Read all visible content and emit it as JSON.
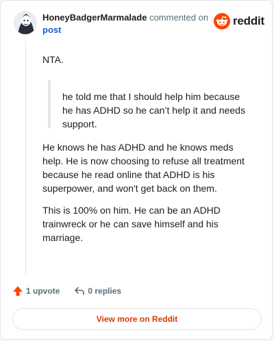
{
  "header": {
    "username": "HoneyBadgerMarmalade",
    "commented_text": "commented on",
    "post_link": "post",
    "logo_text": "reddit"
  },
  "comment": {
    "intro": "NTA.",
    "quote": "he told me that I should help him because he has ADHD so he can’t help it and needs support.",
    "para1": "He knows he has ADHD and he knows meds help. He is now choosing to refuse all treatment because he read online that ADHD is his superpower, and won't get back on them.",
    "para2": "This is 100% on him. He can be an ADHD trainwreck or he can save himself and his marriage."
  },
  "actions": {
    "upvotes": "1 upvote",
    "replies": "0 replies"
  },
  "footer": {
    "view_more": "View more on Reddit"
  },
  "colors": {
    "reddit_orange": "#ff4500",
    "link_blue": "#1c5fcf",
    "view_more_text": "#d93a00",
    "upvote_arrow": "#ff4500"
  },
  "icons": [
    "avatar",
    "reddit-logo-icon",
    "upvote-arrow-icon",
    "reply-icon"
  ]
}
